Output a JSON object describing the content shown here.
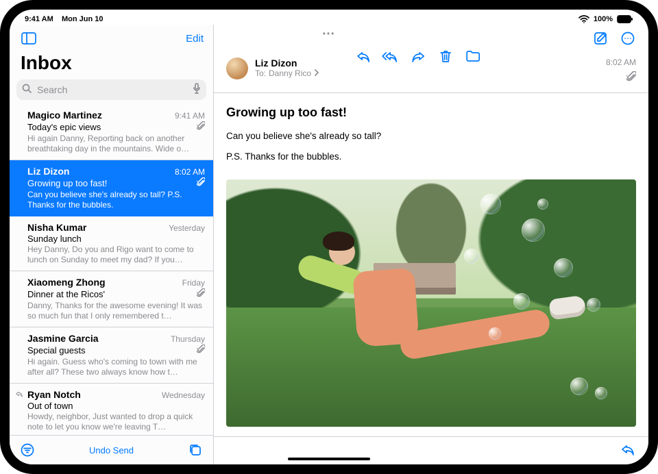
{
  "statusbar": {
    "time": "9:41 AM",
    "date": "Mon Jun 10",
    "battery_pct": "100%"
  },
  "sidebar": {
    "edit_label": "Edit",
    "title": "Inbox",
    "search_placeholder": "Search",
    "undo_label": "Undo Send"
  },
  "messages": [
    {
      "sender": "Magico Martinez",
      "time": "9:41 AM",
      "subject": "Today's epic views",
      "preview": "Hi again Danny, Reporting back on another breathtaking day in the mountains. Wide o…",
      "has_attachment": true,
      "selected": false,
      "replied": false
    },
    {
      "sender": "Liz Dizon",
      "time": "8:02 AM",
      "subject": "Growing up too fast!",
      "preview": "Can you believe she's already so tall? P.S. Thanks for the bubbles.",
      "has_attachment": true,
      "selected": true,
      "replied": false
    },
    {
      "sender": "Nisha Kumar",
      "time": "Yesterday",
      "subject": "Sunday lunch",
      "preview": "Hey Danny, Do you and Rigo want to come to lunch on Sunday to meet my dad? If you…",
      "has_attachment": false,
      "selected": false,
      "replied": false
    },
    {
      "sender": "Xiaomeng Zhong",
      "time": "Friday",
      "subject": "Dinner at the Ricos'",
      "preview": "Danny, Thanks for the awesome evening! It was so much fun that I only remembered t…",
      "has_attachment": true,
      "selected": false,
      "replied": false
    },
    {
      "sender": "Jasmine Garcia",
      "time": "Thursday",
      "subject": "Special guests",
      "preview": "Hi again. Guess who's coming to town with me after all? These two always know how t…",
      "has_attachment": true,
      "selected": false,
      "replied": false
    },
    {
      "sender": "Ryan Notch",
      "time": "Wednesday",
      "subject": "Out of town",
      "preview": "Howdy, neighbor, Just wanted to drop a quick note to let you know we're leaving T…",
      "has_attachment": false,
      "selected": false,
      "replied": true
    }
  ],
  "open_message": {
    "from": "Liz Dizon",
    "to_label": "To:",
    "to_name": "Danny Rico",
    "time": "8:02 AM",
    "has_attachment": true,
    "subject": "Growing up too fast!",
    "body_line1": "Can you believe she's already so tall?",
    "body_line2": "P.S. Thanks for the bubbles."
  }
}
